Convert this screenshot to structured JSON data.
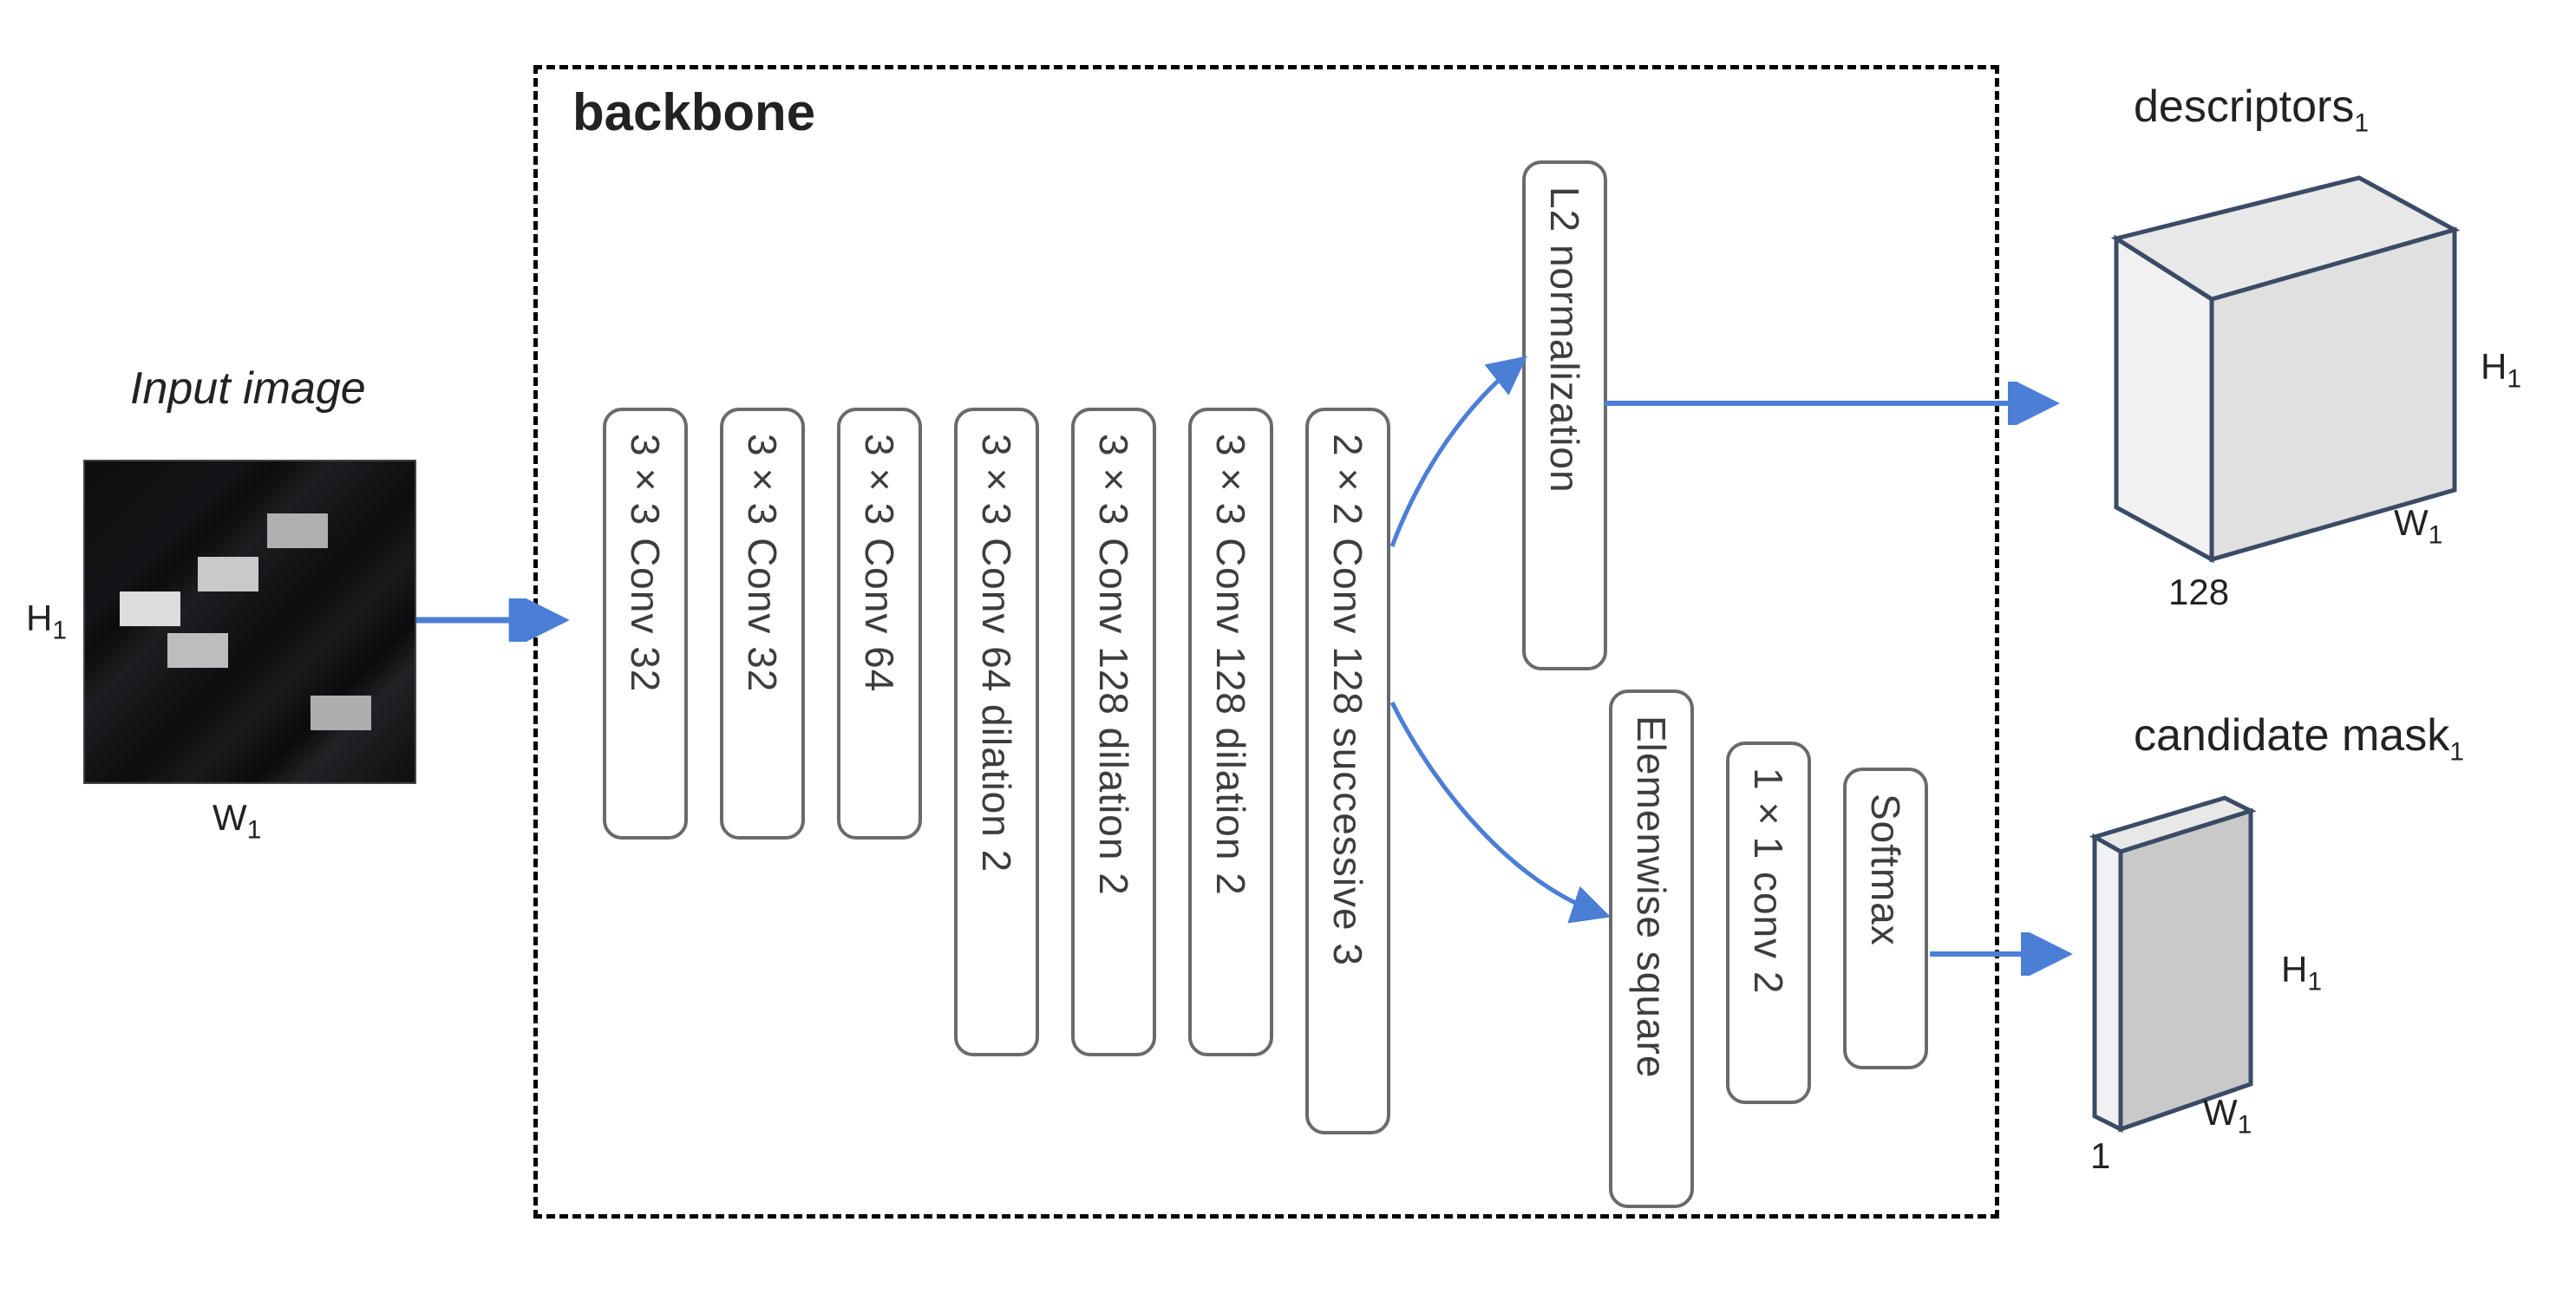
{
  "input": {
    "title": "Input image",
    "h_label": "H₁",
    "w_label": "W₁"
  },
  "backbone": {
    "title": "backbone",
    "layers": [
      "3×3 Conv 32",
      "3×3 Conv 32",
      "3×3 Conv 64",
      "3×3 Conv 64  dilation 2",
      "3×3 Conv 128 dilation 2",
      "3×3 Conv 128  dilation 2",
      "2×2 Conv 128 successive 3"
    ],
    "branch_top": [
      "L2 normalization"
    ],
    "branch_bottom": [
      "Elemenwise square",
      "1×1 conv 2",
      "Softmax"
    ]
  },
  "outputs": {
    "descriptors": {
      "title": "descriptors₁",
      "depth_label": "128",
      "h_label": "H₁",
      "w_label": "W₁"
    },
    "mask": {
      "title": "candidate mask₁",
      "depth_label": "1",
      "h_label": "H₁",
      "w_label": "W₁"
    }
  }
}
